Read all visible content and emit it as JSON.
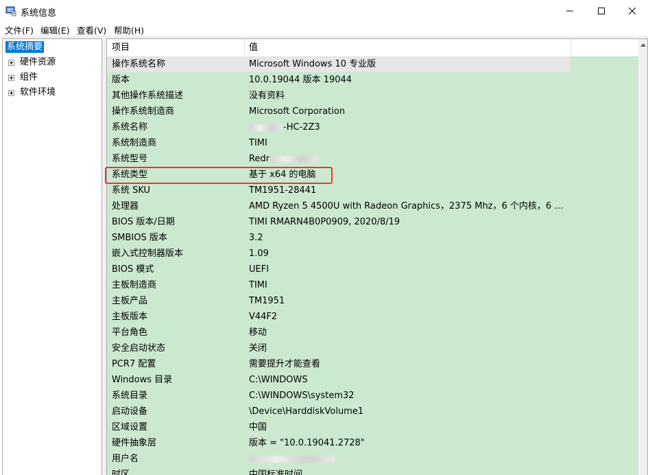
{
  "window": {
    "title": "系统信息",
    "icons": {
      "app": "system-info-icon",
      "minimize": "minimize-icon",
      "maximize": "maximize-icon",
      "close": "close-icon"
    }
  },
  "menu": [
    "文件(F)",
    "编辑(E)",
    "查看(V)",
    "帮助(H)"
  ],
  "tree": {
    "items": [
      {
        "label": "系统摘要",
        "selected": true,
        "expandable": false
      },
      {
        "label": "硬件资源",
        "selected": false,
        "expandable": true
      },
      {
        "label": "组件",
        "selected": false,
        "expandable": true
      },
      {
        "label": "软件环境",
        "selected": false,
        "expandable": true
      }
    ]
  },
  "list": {
    "headers": [
      "项目",
      "值"
    ],
    "rows": [
      {
        "item": "操作系统名称",
        "value": "Microsoft Windows 10 专业版"
      },
      {
        "item": "版本",
        "value": "10.0.19044 版本 19044"
      },
      {
        "item": "其他操作系统描述",
        "value": "没有资料"
      },
      {
        "item": "操作系统制造商",
        "value": "Microsoft Corporation"
      },
      {
        "item": "系统名称",
        "value": "-HC-2Z3"
      },
      {
        "item": "系统制造商",
        "value": "TIMI"
      },
      {
        "item": "系统型号",
        "value": "Redr"
      },
      {
        "item": "系统类型",
        "value": "基于 x64 的电脑"
      },
      {
        "item": "系统 SKU",
        "value": "TM1951-28441"
      },
      {
        "item": "处理器",
        "value": "AMD Ryzen 5 4500U with Radeon Graphics，2375 Mhz，6 个内核，6 个..."
      },
      {
        "item": "BIOS 版本/日期",
        "value": "TIMI RMARN4B0P0909, 2020/8/19"
      },
      {
        "item": "SMBIOS 版本",
        "value": "3.2"
      },
      {
        "item": "嵌入式控制器版本",
        "value": "1.09"
      },
      {
        "item": "BIOS 模式",
        "value": "UEFI"
      },
      {
        "item": "主板制造商",
        "value": "TIMI"
      },
      {
        "item": "主板产品",
        "value": "TM1951"
      },
      {
        "item": "主板版本",
        "value": "V44F2"
      },
      {
        "item": "平台角色",
        "value": "移动"
      },
      {
        "item": "安全启动状态",
        "value": "关闭"
      },
      {
        "item": "PCR7 配置",
        "value": "需要提升才能查看"
      },
      {
        "item": "Windows 目录",
        "value": "C:\\WINDOWS"
      },
      {
        "item": "系统目录",
        "value": "C:\\WINDOWS\\system32"
      },
      {
        "item": "启动设备",
        "value": "\\Device\\HarddiskVolume1"
      },
      {
        "item": "区域设置",
        "value": "中国"
      },
      {
        "item": "硬件抽象层",
        "value": "版本 = \"10.0.19041.2728\""
      },
      {
        "item": "用户名",
        "value": ""
      },
      {
        "item": "时区",
        "value": "中国标准时间"
      }
    ]
  },
  "colors": {
    "row_bg": "#cce8cf",
    "selected_row_bg": "#e6e6e6",
    "highlight": "#e53935",
    "tree_selected": "#0078d7"
  }
}
